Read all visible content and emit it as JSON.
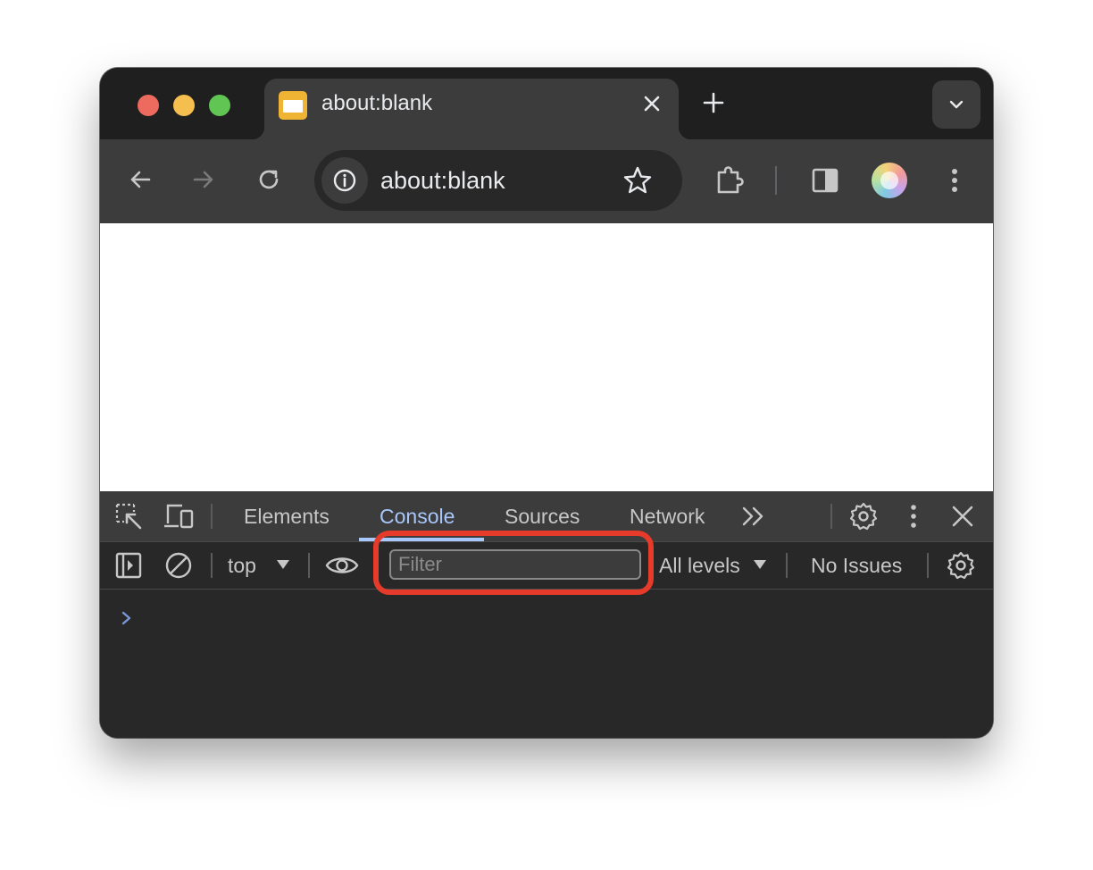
{
  "browser": {
    "tab": {
      "title": "about:blank"
    },
    "toolbar": {
      "url": "about:blank"
    }
  },
  "devtools": {
    "tabs": [
      "Elements",
      "Console",
      "Sources",
      "Network"
    ],
    "active_tab": "Console",
    "console_toolbar": {
      "context": "top",
      "filter_placeholder": "Filter",
      "filter_value": "",
      "levels": "All levels",
      "issues": "No Issues"
    }
  },
  "colors": {
    "accent": "#a8c7fa",
    "highlight": "#e63a2a",
    "traffic_red": "#ed6a5e",
    "traffic_yellow": "#f5bf4f",
    "traffic_green": "#61c554"
  }
}
